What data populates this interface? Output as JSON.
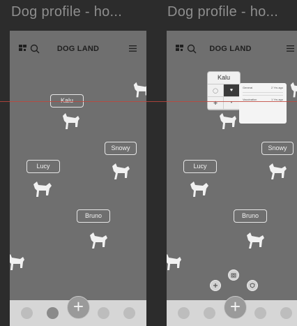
{
  "frames": [
    {
      "title": "Dog profile - ho...",
      "header": {
        "app_name": "DOG LAND"
      },
      "dogs": [
        {
          "name": "Kalu",
          "tagged": true
        },
        {
          "name": "Snowy",
          "tagged": true
        },
        {
          "name": "Lucy",
          "tagged": true
        },
        {
          "name": "Bruno",
          "tagged": true
        }
      ]
    },
    {
      "title": "Dog profile - ho...",
      "header": {
        "app_name": "DOG LAND"
      },
      "dogs": [
        {
          "name": "Kalu",
          "tagged": true
        },
        {
          "name": "Snowy",
          "tagged": true
        },
        {
          "name": "Lucy",
          "tagged": true
        },
        {
          "name": "Bruno",
          "tagged": true
        }
      ],
      "popup": {
        "name": "Kalu",
        "info": [
          {
            "label": "General",
            "value": "2 Yrs ago"
          },
          {
            "label": "Vaccination",
            "value": "1 Yrs ago"
          }
        ]
      }
    }
  ],
  "colors": {
    "background": "#2c2c2c",
    "frame": "#6f6f6f",
    "bottom_bar": "#d6d6d6",
    "guide_line": "#c0473d"
  },
  "icons": {
    "menu": "grid-menu-icon",
    "search": "search-icon",
    "hamburger": "hamburger-icon",
    "add": "plus-icon"
  }
}
